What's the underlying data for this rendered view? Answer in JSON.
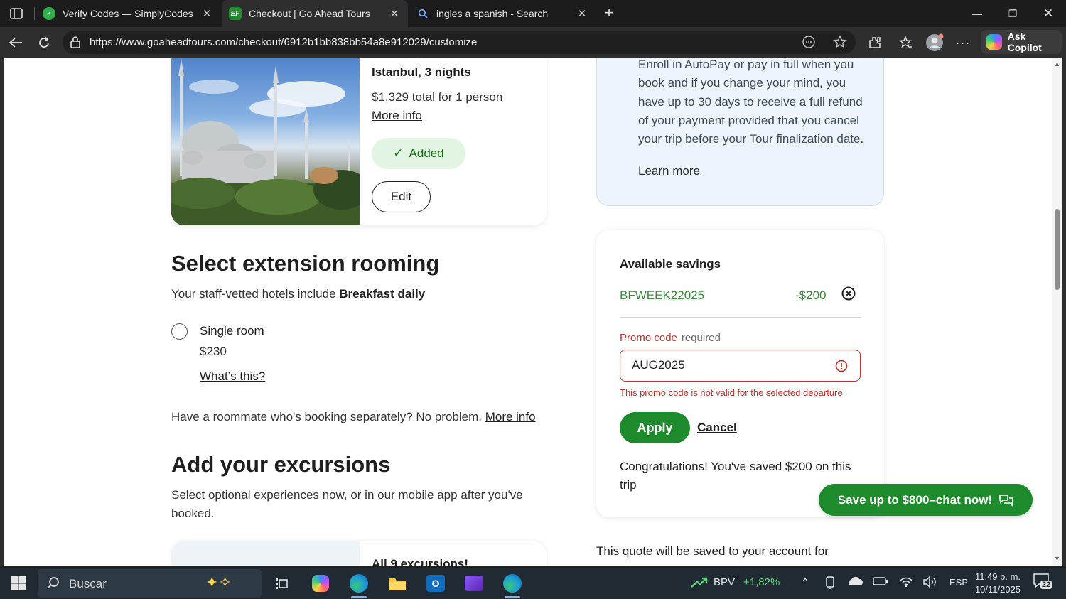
{
  "browser": {
    "tabs": [
      {
        "title": "Verify Codes — SimplyCodes",
        "active": false,
        "favicon": "simplycodes-icon"
      },
      {
        "title": "Checkout | Go Ahead Tours",
        "active": true,
        "favicon": "ef-icon"
      },
      {
        "title": "ingles a spanish - Search",
        "active": false,
        "favicon": "search-icon"
      }
    ],
    "url": "https://www.goaheadtours.com/checkout/6912b1bb838bb54a8e912029/customize",
    "copilot_label": "Ask Copilot"
  },
  "hotel": {
    "title": "Istanbul, 3 nights",
    "price": "$1,329 total for 1 person",
    "more_info": "More info",
    "added_label": "Added",
    "edit_label": "Edit"
  },
  "rooming": {
    "heading": "Select extension rooming",
    "subtitle_prefix": "Your staff-vetted hotels include ",
    "subtitle_bold": "Breakfast daily",
    "option_label": "Single room",
    "option_price": "$230",
    "whats_this": "What’s this?",
    "roommate_text": "Have a roommate who's booking separately? No problem. ",
    "roommate_link": "More info"
  },
  "excursions": {
    "heading": "Add your excursions",
    "subtitle": "Select optional experiences now, or in our mobile app after you've booked.",
    "card_title": "All 9 excursions!"
  },
  "autopay": {
    "text": "Enroll in AutoPay or pay in full when you book and if you change your mind, you have up to 30 days to receive a full refund of your payment provided that you cancel your trip before your Tour finalization date.",
    "learn_more": "Learn more"
  },
  "savings": {
    "title": "Available savings",
    "code": "BFWEEK22025",
    "amount": "-$200",
    "promo_label": "Promo code",
    "promo_required": "required",
    "promo_value": "AUG2025",
    "promo_error": "This promo code is not valid for the selected departure",
    "apply_label": "Apply",
    "cancel_label": "Cancel",
    "congrats": "Congratulations! You've saved $200 on this trip"
  },
  "chat": {
    "label": "Save up to $800–chat now!"
  },
  "quote_note": "This quote will be saved to your account for",
  "taskbar": {
    "search_placeholder": "Buscar",
    "stock_name": "BPV",
    "stock_change": "+1,82%",
    "language": "ESP",
    "time": "11:49 p. m.",
    "date": "10/11/2025",
    "notifications": "22"
  },
  "colors": {
    "brand_green": "#1d8a2c",
    "error_red": "#c0322b",
    "savings_green": "#3d8b3d",
    "autopay_bg": "#eef4fb"
  }
}
